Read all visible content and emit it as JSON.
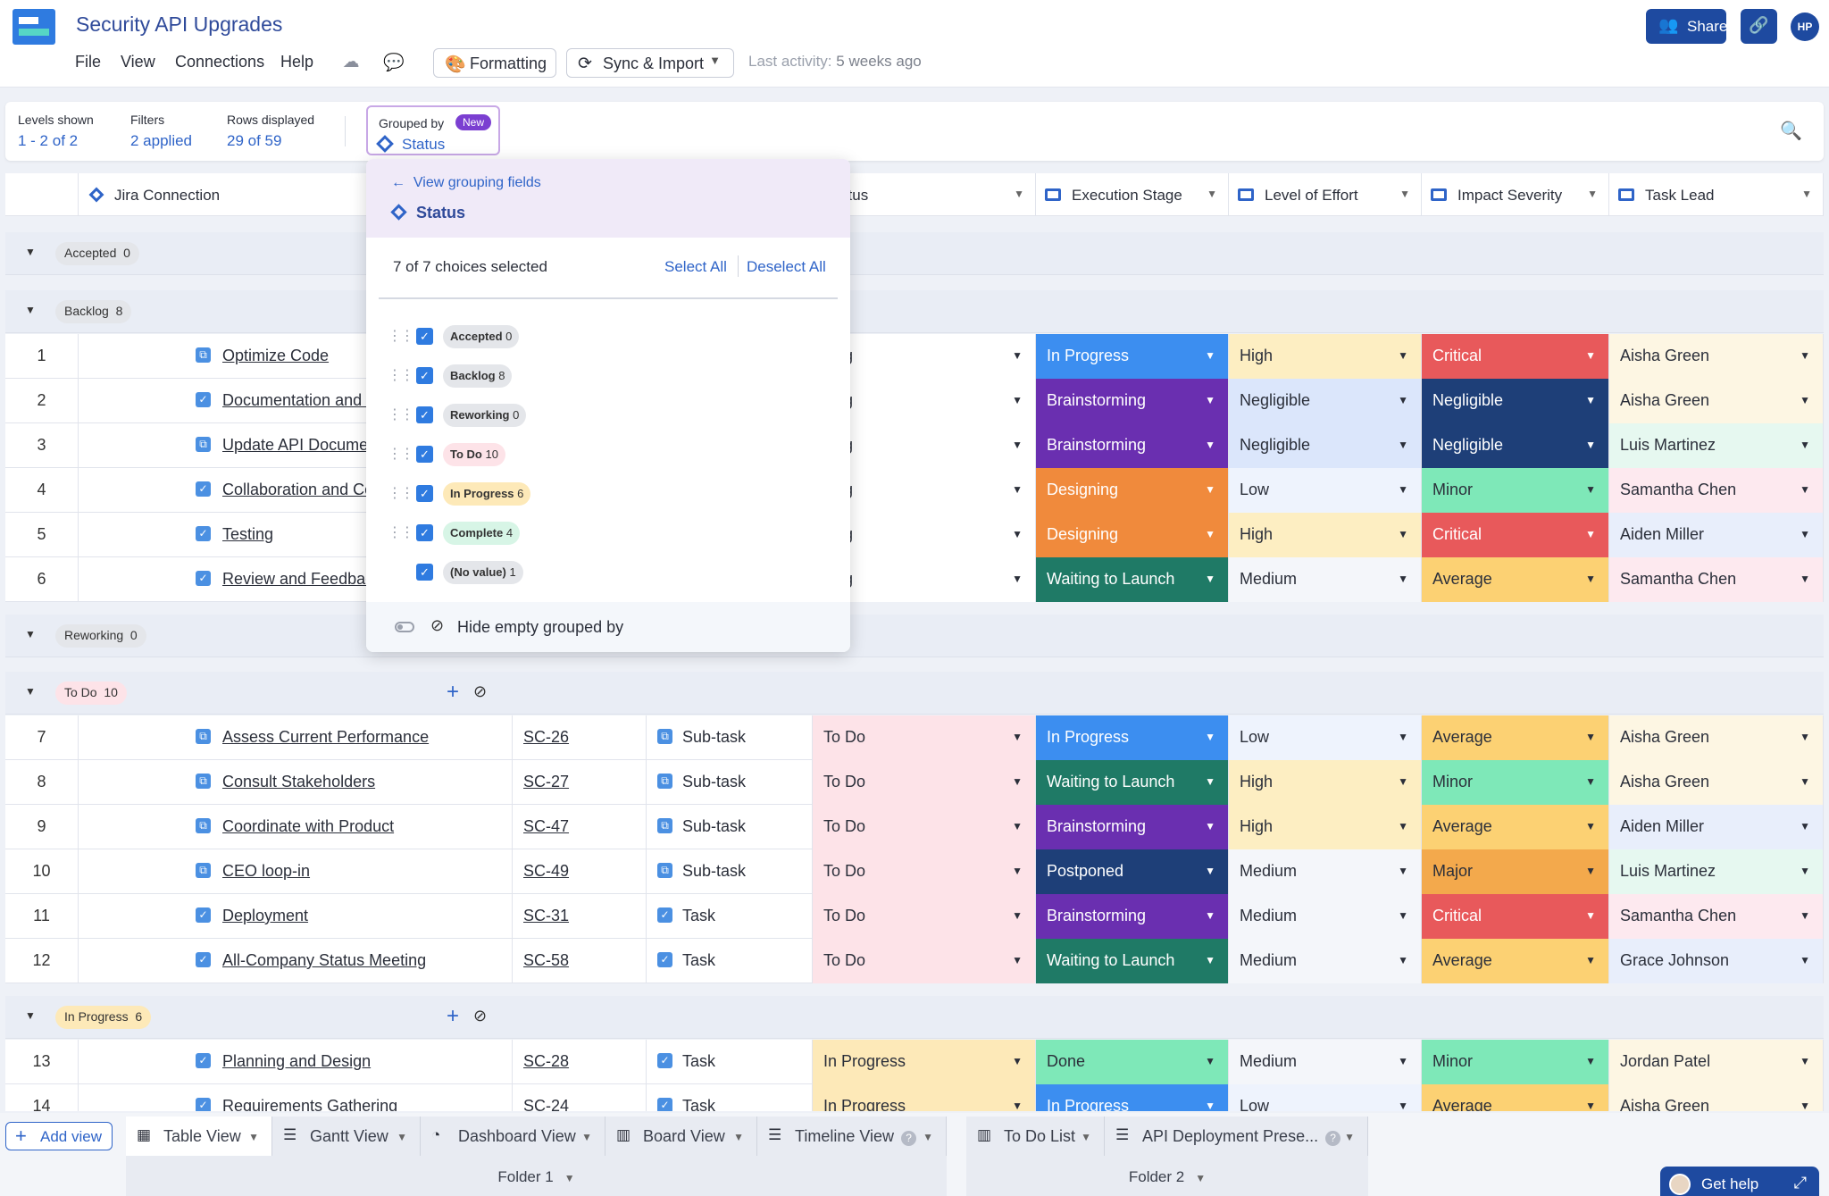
{
  "app": {
    "title": "Security API Upgrades",
    "menu": [
      "File",
      "View",
      "Connections",
      "Help"
    ],
    "formatting_label": "Formatting",
    "sync_label": "Sync & Import",
    "last_activity_label": "Last activity:",
    "last_activity_value": "5 weeks ago",
    "share_label": "Share",
    "avatar_initials": "HP"
  },
  "stats": {
    "levels_label": "Levels shown",
    "levels_value": "1 - 2 of 2",
    "filters_label": "Filters",
    "filters_value": "2 applied",
    "rows_label": "Rows displayed",
    "rows_value": "29 of 59",
    "grouped_label": "Grouped by",
    "grouped_badge": "New",
    "grouped_value": "Status"
  },
  "columns": {
    "jira": "Jira Connection",
    "status": "Status",
    "execution": "Execution Stage",
    "effort": "Level of Effort",
    "impact": "Impact Severity",
    "lead": "Task Lead"
  },
  "popup": {
    "back_label": "View grouping fields",
    "field_label": "Status",
    "count_label": "7 of 7 choices selected",
    "select_all": "Select All",
    "deselect_all": "Deselect All",
    "options": [
      {
        "name": "Accepted",
        "count": "0",
        "color": "#e4e6ea"
      },
      {
        "name": "Backlog",
        "count": "8",
        "color": "#e4e6ea"
      },
      {
        "name": "Reworking",
        "count": "0",
        "color": "#e4e6ea"
      },
      {
        "name": "To Do",
        "count": "10",
        "color": "#fde3e8"
      },
      {
        "name": "In Progress",
        "count": "6",
        "color": "#fde9b8"
      },
      {
        "name": "Complete",
        "count": "4",
        "color": "#d7f5e6"
      },
      {
        "name": "(No value)",
        "count": "1",
        "color": "#e4e6ea"
      }
    ],
    "hide_empty_label": "Hide empty grouped by"
  },
  "groups": {
    "accepted": {
      "name": "Accepted",
      "count": "0"
    },
    "backlog": {
      "name": "Backlog",
      "count": "8"
    },
    "reworking": {
      "name": "Reworking",
      "count": "0"
    },
    "todo": {
      "name": "To Do",
      "count": "10"
    },
    "inprogress": {
      "name": "In Progress",
      "count": "6"
    }
  },
  "colors": {
    "In Progress": "#3c8ef0",
    "Brainstorming": "#6a2fb0",
    "Designing": "#f08a3c",
    "Waiting to Launch": "#1f7a66",
    "Postponed": "#1e3f78",
    "Done": "#7ee8b8",
    "High": "#fdeec2",
    "Negligible": "#dbe6fb",
    "Low": "#eef3fd",
    "Medium": "#f4f6fa",
    "Critical": "#e8595b",
    "Minor": "#7ee8b8",
    "Average": "#fcd173",
    "Major": "#f3a94c",
    "NegligibleImpact": "#1e3f78",
    "To Do": "#fde3e8",
    "InProgressStatus": "#fde9b8"
  },
  "rows": [
    {
      "num": "1",
      "name": "Optimize Code",
      "key": "",
      "type": "",
      "status": "klog",
      "exec": "In Progress",
      "effort": "High",
      "impact": "Critical",
      "lead": "Aisha Green",
      "sub": true
    },
    {
      "num": "2",
      "name": "Documentation and Training",
      "key": "",
      "type": "",
      "status": "klog",
      "exec": "Brainstorming",
      "effort": "Negligible",
      "impact": "Negligible",
      "lead": "Aisha Green",
      "sub": false
    },
    {
      "num": "3",
      "name": "Update API Documentation",
      "key": "",
      "type": "",
      "status": "klog",
      "exec": "Brainstorming",
      "effort": "Negligible",
      "impact": "Negligible",
      "lead": "Luis Martinez",
      "sub": true
    },
    {
      "num": "4",
      "name": "Collaboration and Communicati",
      "key": "",
      "type": "",
      "status": "klog",
      "exec": "Designing",
      "effort": "Low",
      "impact": "Minor",
      "lead": "Samantha Chen",
      "sub": false
    },
    {
      "num": "5",
      "name": "Testing",
      "key": "",
      "type": "",
      "status": "klog",
      "exec": "Designing",
      "effort": "High",
      "impact": "Critical",
      "lead": "Aiden Miller",
      "sub": false
    },
    {
      "num": "6",
      "name": "Review and Feedback",
      "key": "",
      "type": "",
      "status": "klog",
      "exec": "Waiting to Launch",
      "effort": "Medium",
      "impact": "Average",
      "lead": "Samantha Chen",
      "sub": false
    },
    {
      "num": "7",
      "name": "Assess Current Performance",
      "key": "SC-26",
      "type": "Sub-task",
      "status": "To Do",
      "exec": "In Progress",
      "effort": "Low",
      "impact": "Average",
      "lead": "Aisha Green",
      "sub": true
    },
    {
      "num": "8",
      "name": "Consult Stakeholders",
      "key": "SC-27",
      "type": "Sub-task",
      "status": "To Do",
      "exec": "Waiting to Launch",
      "effort": "High",
      "impact": "Minor",
      "lead": "Aisha Green",
      "sub": true
    },
    {
      "num": "9",
      "name": "Coordinate with Product",
      "key": "SC-47",
      "type": "Sub-task",
      "status": "To Do",
      "exec": "Brainstorming",
      "effort": "High",
      "impact": "Average",
      "lead": "Aiden Miller",
      "sub": true
    },
    {
      "num": "10",
      "name": "CEO loop-in",
      "key": "SC-49",
      "type": "Sub-task",
      "status": "To Do",
      "exec": "Postponed",
      "effort": "Medium",
      "impact": "Major",
      "lead": "Luis Martinez",
      "sub": true
    },
    {
      "num": "11",
      "name": "Deployment",
      "key": "SC-31",
      "type": "Task",
      "status": "To Do",
      "exec": "Brainstorming",
      "effort": "Medium",
      "impact": "Critical",
      "lead": "Samantha Chen",
      "sub": false
    },
    {
      "num": "12",
      "name": "All-Company Status Meeting",
      "key": "SC-58",
      "type": "Task",
      "status": "To Do",
      "exec": "Waiting to Launch",
      "effort": "Medium",
      "impact": "Average",
      "lead": "Grace Johnson",
      "sub": false
    },
    {
      "num": "13",
      "name": "Planning and Design",
      "key": "SC-28",
      "type": "Task",
      "status": "In Progress",
      "exec": "Done",
      "effort": "Medium",
      "impact": "Minor",
      "lead": "Jordan Patel",
      "sub": false
    },
    {
      "num": "14",
      "name": "Requirements Gathering",
      "key": "SC-24",
      "type": "Task",
      "status": "In Progress",
      "exec": "In Progress",
      "effort": "Low",
      "impact": "Average",
      "lead": "Aisha Green",
      "sub": false
    }
  ],
  "tabs": {
    "add_view": "Add view",
    "views": [
      "Table View",
      "Gantt View",
      "Dashboard View",
      "Board View",
      "Timeline View",
      "To Do List",
      "API Deployment Prese..."
    ],
    "folders": [
      "Folder 1",
      "Folder 2"
    ],
    "get_help": "Get help"
  }
}
